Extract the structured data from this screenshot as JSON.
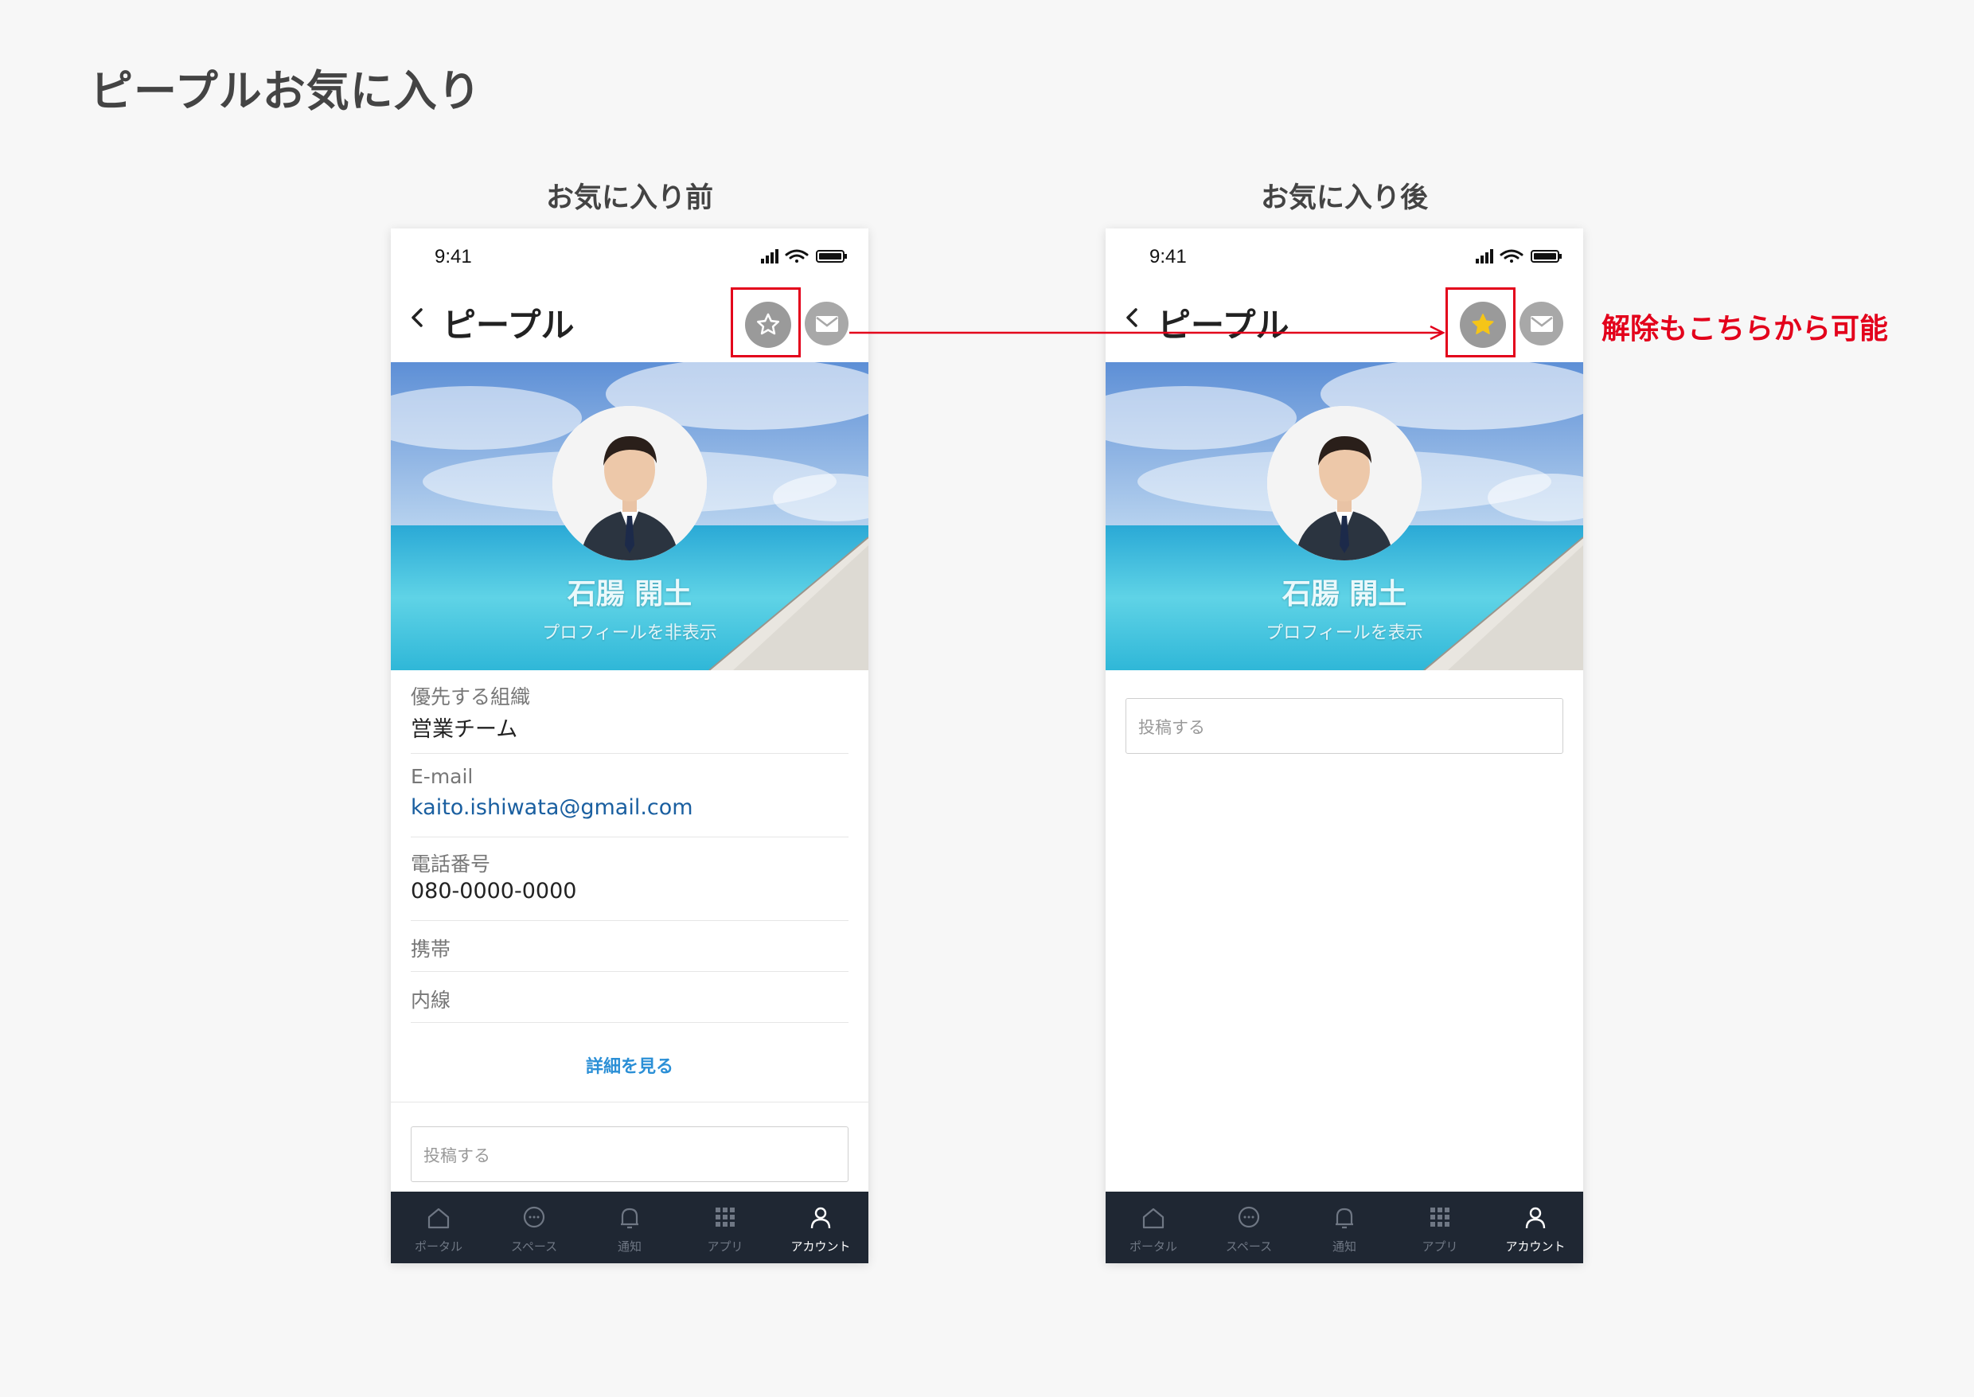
{
  "page": {
    "title": "ピープルお気に入り"
  },
  "captions": {
    "before": "お気に入り前",
    "after": "お気に入り後"
  },
  "annotation": {
    "text": "解除もこちらから可能",
    "color": "#e3001b"
  },
  "before": {
    "status_time": "9:41",
    "nav_title": "ピープル",
    "favorite_icon": "star-outline-icon",
    "profile_name": "石腸 開土",
    "profile_toggle": "プロフィールを非表示",
    "fields": [
      {
        "label": "優先する組織",
        "value": "営業チーム"
      },
      {
        "label": "E-mail",
        "value": "kaito.ishiwata@gmail.com"
      },
      {
        "label": "電話番号",
        "value": "080-0000-0000"
      },
      {
        "label": "携帯",
        "value": ""
      },
      {
        "label": "内線",
        "value": ""
      }
    ],
    "detail_link": "詳細を見る",
    "post_placeholder": "投稿する"
  },
  "after": {
    "status_time": "9:41",
    "nav_title": "ピープル",
    "favorite_icon": "star-filled-icon",
    "profile_name": "石腸 開土",
    "profile_toggle": "プロフィールを表示",
    "post_placeholder": "投稿する"
  },
  "tabs": [
    {
      "label": "ポータル",
      "icon": "home-icon",
      "active": false
    },
    {
      "label": "スペース",
      "icon": "chat-bubble-icon",
      "active": false
    },
    {
      "label": "通知",
      "icon": "bell-icon",
      "active": false
    },
    {
      "label": "アプリ",
      "icon": "grid-icon",
      "active": false
    },
    {
      "label": "アカウント",
      "icon": "person-icon",
      "active": true
    }
  ],
  "colors": {
    "accent_red": "#e3001b",
    "star_yellow": "#f5c518",
    "tab_bar": "#1f2733",
    "link_blue": "#2b8fd6"
  }
}
